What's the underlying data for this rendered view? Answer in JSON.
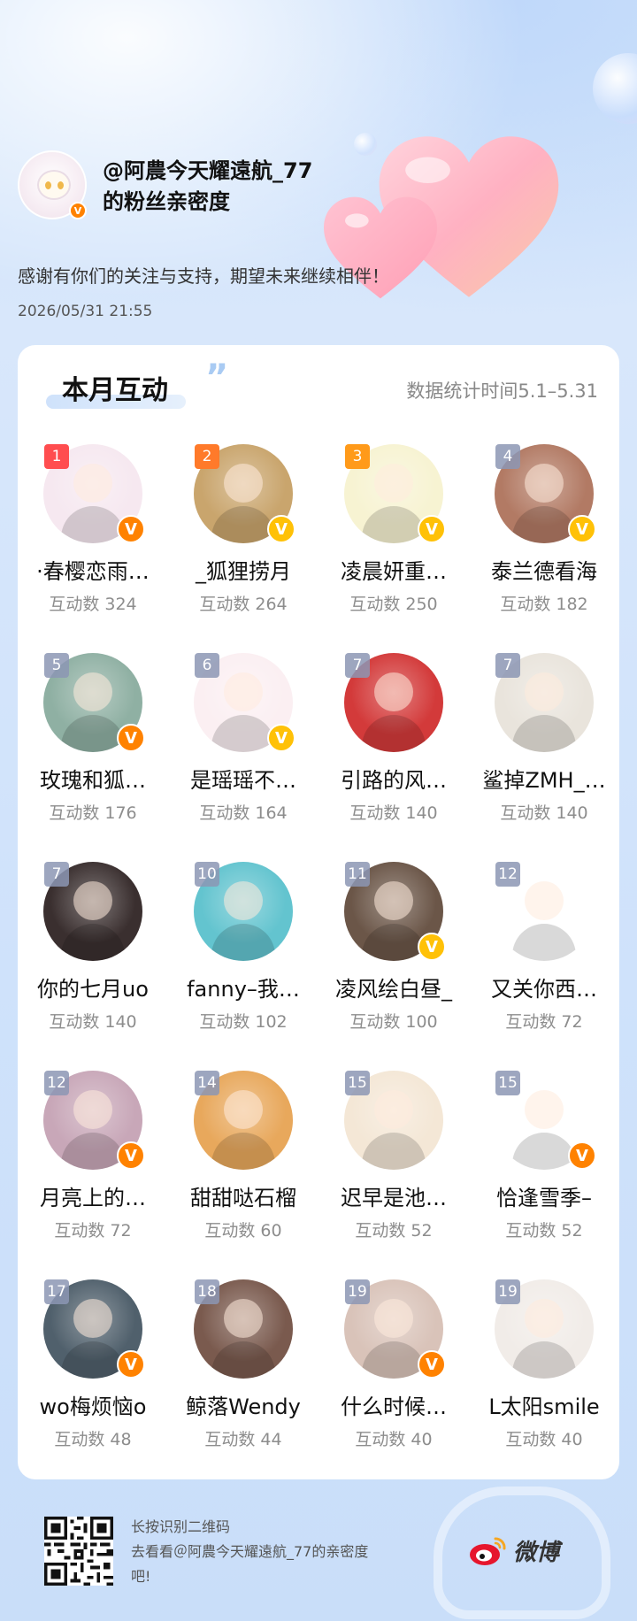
{
  "header": {
    "owner_name_line1": "@阿農今天耀遠航_77",
    "owner_name_line2": "的粉丝亲密度",
    "thanks": "感谢有你们的关注与支持，期望未来继续相伴！",
    "timestamp": "2026/05/31 21:55"
  },
  "card": {
    "title": "本月互动",
    "period": "数据统计时间5.1–5.31"
  },
  "count_prefix": "互动数",
  "fans": [
    {
      "rank": "1",
      "name": "·春樱恋雨…",
      "count": "互动数 324",
      "verified": "orange",
      "bg": "#f6e8f0"
    },
    {
      "rank": "2",
      "name": "_狐狸捞月",
      "count": "互动数 264",
      "verified": "gold",
      "bg": "#c9a56d"
    },
    {
      "rank": "3",
      "name": "凌晨妍重…",
      "count": "互动数 250",
      "verified": "gold",
      "bg": "#f7f3d2"
    },
    {
      "rank": "4",
      "name": "泰兰德看海",
      "count": "互动数 182",
      "verified": "gold",
      "bg": "#b27a64"
    },
    {
      "rank": "5",
      "name": "玫瑰和狐…",
      "count": "互动数 176",
      "verified": "orange",
      "bg": "#8fb0a3"
    },
    {
      "rank": "6",
      "name": "是瑶瑶不…",
      "count": "互动数 164",
      "verified": "gold",
      "bg": "#fbeff2"
    },
    {
      "rank": "7",
      "name": "引路的风…",
      "count": "互动数 140",
      "verified": "",
      "bg": "#d33a3a"
    },
    {
      "rank": "7",
      "name": "鲨掉ZMH_…",
      "count": "互动数 140",
      "verified": "",
      "bg": "#e9e4dc"
    },
    {
      "rank": "7",
      "name": "你的七月uo",
      "count": "互动数 140",
      "verified": "",
      "bg": "#3a2f2f"
    },
    {
      "rank": "10",
      "name": "fanny–我…",
      "count": "互动数 102",
      "verified": "",
      "bg": "#63c4cf"
    },
    {
      "rank": "11",
      "name": "凌风绘白昼_",
      "count": "互动数 100",
      "verified": "gold",
      "bg": "#6b5648"
    },
    {
      "rank": "12",
      "name": "又关你西…",
      "count": "互动数 72",
      "verified": "",
      "bg": "#ffffff"
    },
    {
      "rank": "12",
      "name": "月亮上的…",
      "count": "互动数 72",
      "verified": "orange",
      "bg": "#c8a7b8"
    },
    {
      "rank": "14",
      "name": "甜甜哒石榴",
      "count": "互动数 60",
      "verified": "",
      "bg": "#e8a85c"
    },
    {
      "rank": "15",
      "name": "迟早是池…",
      "count": "互动数 52",
      "verified": "",
      "bg": "#f4e7d6"
    },
    {
      "rank": "15",
      "name": "恰逢雪季–",
      "count": "互动数 52",
      "verified": "orange",
      "bg": "#ffffff"
    },
    {
      "rank": "17",
      "name": "wo梅烦恼o",
      "count": "互动数 48",
      "verified": "orange",
      "bg": "#50606c"
    },
    {
      "rank": "18",
      "name": "鲸落Wendy",
      "count": "互动数 44",
      "verified": "",
      "bg": "#7a5a4e"
    },
    {
      "rank": "19",
      "name": "什么时候…",
      "count": "互动数 40",
      "verified": "orange",
      "bg": "#d9c3b9"
    },
    {
      "rank": "19",
      "name": "L太阳smile",
      "count": "互动数 40",
      "verified": "",
      "bg": "#f1ece8"
    }
  ],
  "footer": {
    "line1": "长按识别二维码",
    "line2": "去看看＠阿農今天耀遠航_77的亲密度吧!",
    "brand": "微博"
  },
  "colors": {
    "rank1": "#ff4d4f",
    "rank2": "#ff7a2a",
    "rank3": "#ff9a1a",
    "verified_orange": "#ff8200",
    "verified_gold": "#ffc107"
  }
}
